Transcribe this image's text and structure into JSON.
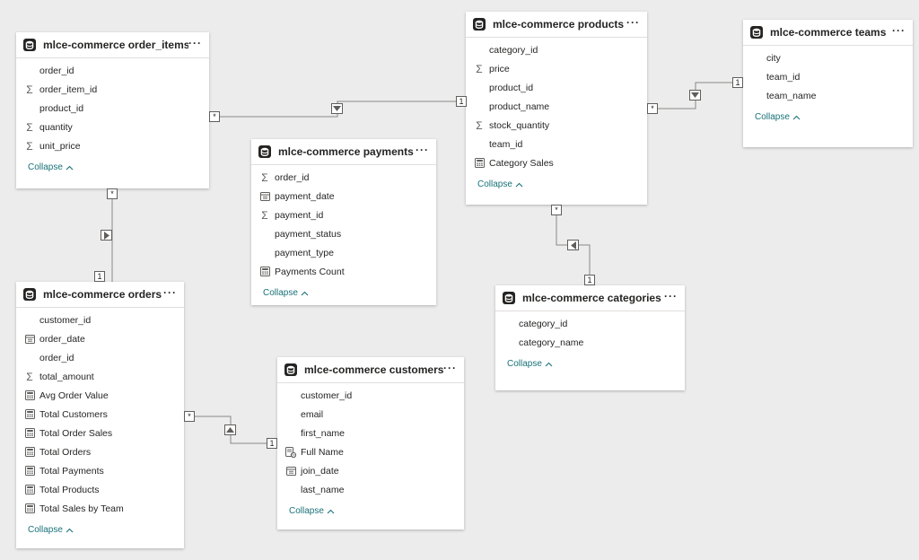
{
  "collapse_label": "Collapse",
  "colors": {
    "accent": "#197278",
    "line": "#8a8886",
    "canvas": "#ececec"
  },
  "tables": [
    {
      "id": "order_items",
      "title": "mlce-commerce order_items",
      "fields": [
        {
          "name": "order_id",
          "icon": "none"
        },
        {
          "name": "order_item_id",
          "icon": "sigma-icon"
        },
        {
          "name": "product_id",
          "icon": "none"
        },
        {
          "name": "quantity",
          "icon": "sigma-icon"
        },
        {
          "name": "unit_price",
          "icon": "sigma-icon"
        }
      ]
    },
    {
      "id": "products",
      "title": "mlce-commerce products",
      "fields": [
        {
          "name": "category_id",
          "icon": "none"
        },
        {
          "name": "price",
          "icon": "sigma-icon"
        },
        {
          "name": "product_id",
          "icon": "none"
        },
        {
          "name": "product_name",
          "icon": "none"
        },
        {
          "name": "stock_quantity",
          "icon": "sigma-icon"
        },
        {
          "name": "team_id",
          "icon": "none"
        },
        {
          "name": "Category Sales",
          "icon": "calculator-icon"
        }
      ]
    },
    {
      "id": "teams",
      "title": "mlce-commerce teams",
      "fields": [
        {
          "name": "city",
          "icon": "none"
        },
        {
          "name": "team_id",
          "icon": "none"
        },
        {
          "name": "team_name",
          "icon": "none"
        }
      ]
    },
    {
      "id": "payments",
      "title": "mlce-commerce payments",
      "fields": [
        {
          "name": "order_id",
          "icon": "sigma-icon"
        },
        {
          "name": "payment_date",
          "icon": "calendar-icon"
        },
        {
          "name": "payment_id",
          "icon": "sigma-icon"
        },
        {
          "name": "payment_status",
          "icon": "none"
        },
        {
          "name": "payment_type",
          "icon": "none"
        },
        {
          "name": "Payments Count",
          "icon": "calculator-icon"
        }
      ]
    },
    {
      "id": "orders",
      "title": "mlce-commerce orders",
      "fields": [
        {
          "name": "customer_id",
          "icon": "none"
        },
        {
          "name": "order_date",
          "icon": "calendar-icon"
        },
        {
          "name": "order_id",
          "icon": "none"
        },
        {
          "name": "total_amount",
          "icon": "sigma-icon"
        },
        {
          "name": "Avg Order Value",
          "icon": "calculator-icon"
        },
        {
          "name": "Total Customers",
          "icon": "calculator-icon"
        },
        {
          "name": "Total Order Sales",
          "icon": "calculator-icon"
        },
        {
          "name": "Total Orders",
          "icon": "calculator-icon"
        },
        {
          "name": "Total Payments",
          "icon": "calculator-icon"
        },
        {
          "name": "Total Products",
          "icon": "calculator-icon"
        },
        {
          "name": "Total Sales by Team",
          "icon": "calculator-icon"
        }
      ]
    },
    {
      "id": "categories",
      "title": "mlce-commerce categories",
      "fields": [
        {
          "name": "category_id",
          "icon": "none"
        },
        {
          "name": "category_name",
          "icon": "none"
        }
      ]
    },
    {
      "id": "customers",
      "title": "mlce-commerce customers",
      "fields": [
        {
          "name": "customer_id",
          "icon": "none"
        },
        {
          "name": "email",
          "icon": "none"
        },
        {
          "name": "first_name",
          "icon": "none"
        },
        {
          "name": "Full Name",
          "icon": "calculated-column-icon"
        },
        {
          "name": "join_date",
          "icon": "calendar-icon"
        },
        {
          "name": "last_name",
          "icon": "none"
        }
      ]
    }
  ],
  "relationships": [
    {
      "id": "rel-orderitems-products",
      "many_label": "*",
      "one_label": "1",
      "direction": "down"
    },
    {
      "id": "rel-products-teams",
      "many_label": "*",
      "one_label": "1",
      "direction": "down"
    },
    {
      "id": "rel-orderitems-orders",
      "many_label": "*",
      "one_label": "1",
      "direction": "right"
    },
    {
      "id": "rel-products-categories",
      "many_label": "*",
      "one_label": "1",
      "direction": "left"
    },
    {
      "id": "rel-orders-customers",
      "many_label": "*",
      "one_label": "1",
      "direction": "up"
    }
  ]
}
